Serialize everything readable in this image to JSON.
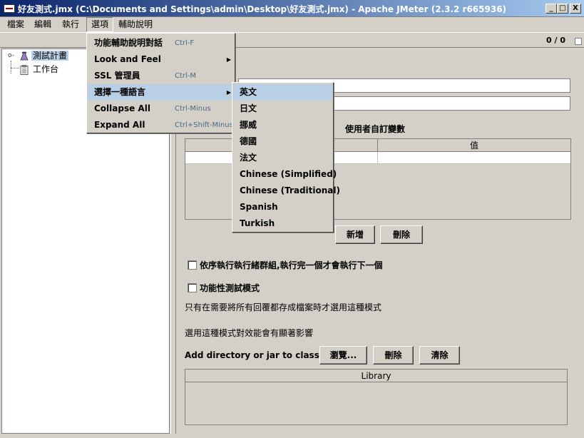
{
  "window": {
    "title": "好友測式.jmx (C:\\Documents and Settings\\admin\\Desktop\\好友測式.jmx) - Apache JMeter (2.3.2 r665936)",
    "buttons": {
      "minimize": "_",
      "maximize": "□",
      "close": "X"
    }
  },
  "menubar": {
    "items": [
      "檔案",
      "編輯",
      "執行",
      "選項",
      "輔助說明"
    ]
  },
  "toolbar": {
    "run_count": "0 / 0"
  },
  "tree": {
    "nodes": [
      {
        "label": "測試計畫",
        "icon": "test-plan-icon",
        "selected": true
      },
      {
        "label": "工作台",
        "icon": "workbench-icon",
        "selected": false
      }
    ]
  },
  "options_menu": {
    "items": [
      {
        "label": "功能輔助說明對話",
        "accel": "Ctrl-F",
        "submenu": false
      },
      {
        "label": "Look and Feel",
        "accel": "",
        "submenu": true
      },
      {
        "label": "SSL 管理員",
        "accel": "Ctrl-M",
        "submenu": false
      },
      {
        "label": "選擇一種語言",
        "accel": "",
        "submenu": true,
        "highlighted": true
      },
      {
        "label": "Collapse All",
        "accel": "Ctrl-Minus",
        "submenu": false
      },
      {
        "label": "Expand All",
        "accel": "Ctrl+Shift-Minus",
        "submenu": false
      }
    ]
  },
  "language_menu": {
    "items": [
      "英文",
      "日文",
      "挪威",
      "德國",
      "法文",
      "Chinese (Simplified)",
      "Chinese (Traditional)",
      "Spanish",
      "Turkish"
    ],
    "highlighted_index": 0
  },
  "panel": {
    "name_value": "",
    "comments_value": "",
    "user_vars_title": "使用者自訂變數",
    "user_vars_columns": [
      "",
      "值"
    ],
    "add_button": "新增",
    "delete_button": "刪除",
    "serial_threads_label": "依序執行執行緒群組,執行完一個才會執行下一個",
    "serial_threads_checked": false,
    "functional_mode_label": "功能性測試模式",
    "functional_mode_checked": false,
    "functional_note_1": "只有在需要將所有回覆都存成檔案時才選用這種模式",
    "functional_note_2": "選用這種模式對效能會有顯著影響",
    "classpath_label": "Add directory or jar to classpath",
    "browse_button": "瀏覽...",
    "cp_delete_button": "刪除",
    "clear_button": "清除",
    "library_column": "Library"
  },
  "colors": {
    "title_start": "#0a246a",
    "title_end": "#a6caf0",
    "face": "#d4d0c8",
    "selection": "#b8cfe5",
    "accelerator": "#4a6a8a"
  }
}
